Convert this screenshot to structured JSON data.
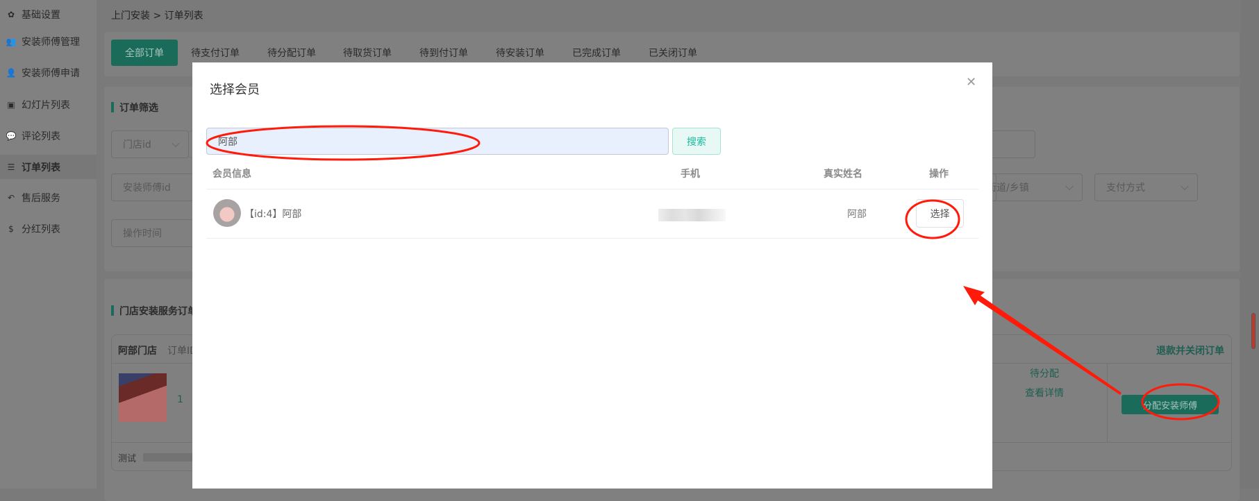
{
  "sidebar": {
    "items": [
      {
        "label": "基础设置",
        "icon": "gear-icon",
        "glyph": "✿"
      },
      {
        "label": "安装师傅管理",
        "icon": "users-icon",
        "glyph": "👥"
      },
      {
        "label": "安装师傅申请",
        "icon": "user-icon",
        "glyph": "👤"
      },
      {
        "label": "幻灯片列表",
        "icon": "image-icon",
        "glyph": "▣"
      },
      {
        "label": "评论列表",
        "icon": "comments-icon",
        "glyph": "💬"
      },
      {
        "label": "订单列表",
        "icon": "list-icon",
        "glyph": "☰",
        "active": true
      },
      {
        "label": "售后服务",
        "icon": "reply-all-icon",
        "glyph": "↶"
      },
      {
        "label": "分红列表",
        "icon": "dollar-icon",
        "glyph": "$"
      }
    ]
  },
  "breadcrumb": "上门安装 > 订单列表",
  "tabs": [
    "全部订单",
    "待支付订单",
    "待分配订单",
    "待取货订单",
    "待到付订单",
    "待安装订单",
    "已完成订单",
    "已关闭订单"
  ],
  "filter": {
    "title": "订单筛选",
    "store_id": "门店id",
    "installer_id": "安装师傅id",
    "operate_time": "操作时间",
    "street": "街道/乡镇",
    "pay_method": "支付方式"
  },
  "orders": {
    "title": "门店安装服务订单",
    "store_name": "阿部门店",
    "order_id_label": "订单ID",
    "refund_close": "退款并关闭订单",
    "quantity": "1",
    "status": "待分配",
    "view_detail": "查看详情",
    "assign_button": "分配安装师傅",
    "remark_label": "测试"
  },
  "modal": {
    "title": "选择会员",
    "search_value": "阿部",
    "search_button": "搜索",
    "columns": [
      "会员信息",
      "手机",
      "真实姓名",
      "操作"
    ],
    "rows": [
      {
        "member": "【id:4】阿部",
        "real_name": "阿部",
        "action": "选择"
      }
    ]
  },
  "colors": {
    "accent": "#1a6b5a",
    "annotation": "#ff1a0a",
    "search_button_text": "#1abc9c"
  }
}
